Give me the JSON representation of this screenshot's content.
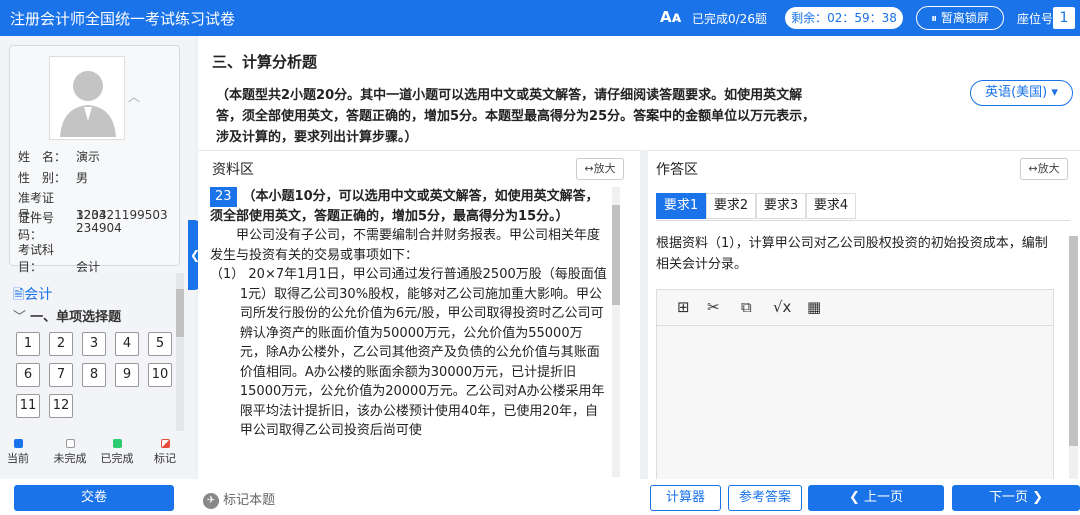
{
  "header": {
    "title": "注册会计师全国统一考试练习试卷",
    "font_icon": "Aᴀ",
    "progress": "已完成0/26题",
    "timer": "剩余：02：59：38",
    "lock_label": "⏸ 暂离锁屏",
    "seat_label": "座位号",
    "seat_number": "1"
  },
  "candidate": {
    "rows": [
      {
        "label": "姓　名：",
        "value": "演示"
      },
      {
        "label": "性　别：",
        "value": "男"
      },
      {
        "label": "准考证号：",
        "value": "1234"
      },
      {
        "label": "证件号码：",
        "value": "320321199503\n234904"
      },
      {
        "label": "考试科目：",
        "value": "会计"
      }
    ]
  },
  "nav": {
    "subject": "会计",
    "section": "一、单项选择题",
    "questions": [
      "1",
      "2",
      "3",
      "4",
      "5",
      "6",
      "7",
      "8",
      "9",
      "10",
      "11",
      "12"
    ]
  },
  "legend": {
    "current": "当前",
    "unanswered": "未完成",
    "answered": "已完成",
    "flagged": "标记"
  },
  "colors": {
    "current": "#1a73e8",
    "answered": "#2ecc71",
    "flagged": "#e74c3c"
  },
  "section": {
    "title": "三、计算分析题",
    "instruction": "（本题型共2小题20分。其中一道小题可以选用中文或英文解答，请仔细阅读答题要求。如使用英文解答，须全部使用英文，答题正确的，增加5分。本题型最高得分为25分。答案中的金额单位以万元表示，涉及计算的，要求列出计算步骤。）",
    "language": "英语(美国) ▾"
  },
  "material": {
    "title": "资料区",
    "expand": "↔放大",
    "qnum": "23",
    "intro": "（本小题10分，可以选用中文或英文解答，如使用英文解答，须全部使用英文，答题正确的，增加5分，最高得分为15分。）",
    "para": "甲公司没有子公司，不需要编制合并财务报表。甲公司相关年度发生与投资有关的交易或事项如下：",
    "item1": "（1） 20×7年1月1日，甲公司通过发行普通股2500万股（每股面值1元）取得乙公司30%股权，能够对乙公司施加重大影响。甲公司所发行股份的公允价值为6元/股，甲公司取得投资时乙公司可辨认净资产的账面价值为50000万元，公允价值为55000万元，除A办公楼外，乙公司其他资产及负债的公允价值与其账面价值相同。A办公楼的账面余额为30000万元，已计提折旧15000万元，公允价值为20000万元。乙公司对A办公楼采用年限平均法计提折旧，该办公楼预计使用40年，已使用20年，自甲公司取得乙公司投资后尚可使"
  },
  "answer": {
    "title": "作答区",
    "expand": "↔放大",
    "tabs": [
      "要求1",
      "要求2",
      "要求3",
      "要求4"
    ],
    "requirement": "根据资料（1），计算甲公司对乙公司股权投资的初始投资成本，编制相关会计分录。"
  },
  "footer": {
    "submit": "交卷",
    "mark": "标记本题",
    "calculator": "计算器",
    "reference": "参考答案",
    "prev": "❮ 上一页",
    "next": "下一页 ❯"
  }
}
